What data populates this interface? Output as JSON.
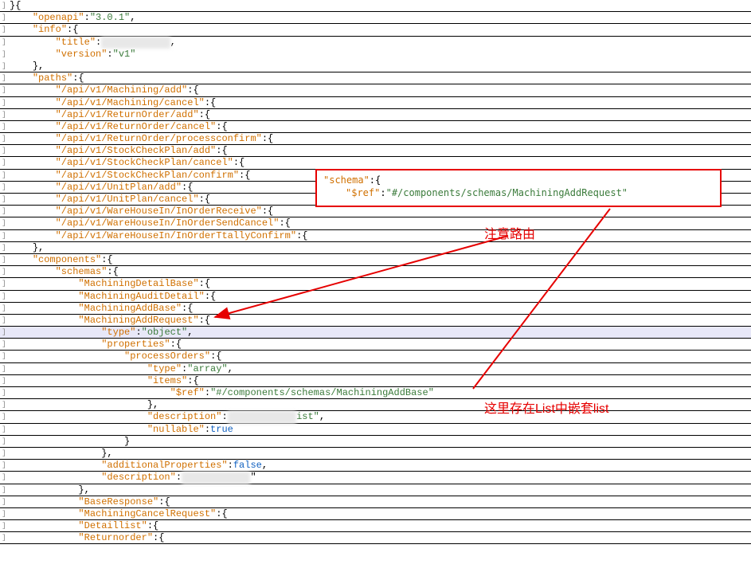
{
  "callout": {
    "line1_key": "\"schema\"",
    "line1_rest": ":{",
    "line2_key": "\"$ref\"",
    "line2_val": "\"#/components/schemas/MachiningAddRequest\""
  },
  "annotations": {
    "top": "注意路由",
    "bottom": "这里存在List中嵌套list"
  },
  "redacted": {
    "title_value": "████████████",
    "desc_suffix": "ist\"",
    "desc2": "████████████"
  },
  "lines": [
    {
      "indent": 0,
      "t": [
        [
          "p",
          "}{"
        ]
      ]
    },
    {
      "indent": 1,
      "t": [
        [
          "k",
          "\"openapi\""
        ],
        [
          "p",
          ":"
        ],
        [
          "s",
          "\"3.0.1\""
        ],
        [
          "p",
          ","
        ]
      ]
    },
    {
      "indent": 1,
      "t": [
        [
          "k",
          "\"info\""
        ],
        [
          "p",
          ":{"
        ]
      ]
    },
    {
      "indent": 2,
      "t": [
        [
          "k",
          "\"title\""
        ],
        [
          "p",
          ":"
        ],
        [
          "blur",
          "redacted.title_value"
        ],
        [
          "p",
          ","
        ]
      ],
      "nb": true
    },
    {
      "indent": 2,
      "t": [
        [
          "k",
          "\"version\""
        ],
        [
          "p",
          ":"
        ],
        [
          "s",
          "\"v1\""
        ]
      ],
      "nb": true
    },
    {
      "indent": 1,
      "t": [
        [
          "p",
          "},"
        ]
      ]
    },
    {
      "indent": 1,
      "t": [
        [
          "k",
          "\"paths\""
        ],
        [
          "p",
          ":{"
        ]
      ]
    },
    {
      "indent": 2,
      "t": [
        [
          "k",
          "\"/api/v1/Machining/add\""
        ],
        [
          "p",
          ":{"
        ]
      ]
    },
    {
      "indent": 2,
      "t": [
        [
          "k",
          "\"/api/v1/Machining/cancel\""
        ],
        [
          "p",
          ":{"
        ]
      ]
    },
    {
      "indent": 2,
      "t": [
        [
          "k",
          "\"/api/v1/ReturnOrder/add\""
        ],
        [
          "p",
          ":{"
        ]
      ]
    },
    {
      "indent": 2,
      "t": [
        [
          "k",
          "\"/api/v1/ReturnOrder/cancel\""
        ],
        [
          "p",
          ":{"
        ]
      ]
    },
    {
      "indent": 2,
      "t": [
        [
          "k",
          "\"/api/v1/ReturnOrder/processconfirm\""
        ],
        [
          "p",
          ":{"
        ]
      ]
    },
    {
      "indent": 2,
      "t": [
        [
          "k",
          "\"/api/v1/StockCheckPlan/add\""
        ],
        [
          "p",
          ":{"
        ]
      ]
    },
    {
      "indent": 2,
      "t": [
        [
          "k",
          "\"/api/v1/StockCheckPlan/cancel\""
        ],
        [
          "p",
          ":{"
        ]
      ]
    },
    {
      "indent": 2,
      "t": [
        [
          "k",
          "\"/api/v1/StockCheckPlan/confirm\""
        ],
        [
          "p",
          ":{"
        ]
      ]
    },
    {
      "indent": 2,
      "t": [
        [
          "k",
          "\"/api/v1/UnitPlan/add\""
        ],
        [
          "p",
          ":{"
        ]
      ]
    },
    {
      "indent": 2,
      "t": [
        [
          "k",
          "\"/api/v1/UnitPlan/cancel\""
        ],
        [
          "p",
          ":{"
        ]
      ]
    },
    {
      "indent": 2,
      "t": [
        [
          "k",
          "\"/api/v1/WareHouseIn/InOrderReceive\""
        ],
        [
          "p",
          ":{"
        ]
      ]
    },
    {
      "indent": 2,
      "t": [
        [
          "k",
          "\"/api/v1/WareHouseIn/InOrderSendCancel\""
        ],
        [
          "p",
          ":{"
        ]
      ]
    },
    {
      "indent": 2,
      "t": [
        [
          "k",
          "\"/api/v1/WareHouseIn/InOrderTtallyConfirm\""
        ],
        [
          "p",
          ":{"
        ]
      ]
    },
    {
      "indent": 1,
      "t": [
        [
          "p",
          "},"
        ]
      ]
    },
    {
      "indent": 1,
      "t": [
        [
          "k",
          "\"components\""
        ],
        [
          "p",
          ":{"
        ]
      ]
    },
    {
      "indent": 2,
      "t": [
        [
          "k",
          "\"schemas\""
        ],
        [
          "p",
          ":{"
        ]
      ]
    },
    {
      "indent": 3,
      "t": [
        [
          "k",
          "\"MachiningDetailBase\""
        ],
        [
          "p",
          ":{"
        ]
      ]
    },
    {
      "indent": 3,
      "t": [
        [
          "k",
          "\"MachiningAuditDetail\""
        ],
        [
          "p",
          ":{"
        ]
      ]
    },
    {
      "indent": 3,
      "t": [
        [
          "k",
          "\"MachiningAddBase\""
        ],
        [
          "p",
          ":{"
        ]
      ]
    },
    {
      "indent": 3,
      "t": [
        [
          "k",
          "\"MachiningAddRequest\""
        ],
        [
          "p",
          ":{"
        ]
      ]
    },
    {
      "indent": 4,
      "t": [
        [
          "k",
          "\"type\""
        ],
        [
          "p",
          ":"
        ],
        [
          "s",
          "\"object\""
        ],
        [
          "p",
          ","
        ]
      ],
      "hl": true
    },
    {
      "indent": 4,
      "t": [
        [
          "k",
          "\"properties\""
        ],
        [
          "p",
          ":{"
        ]
      ]
    },
    {
      "indent": 5,
      "t": [
        [
          "k",
          "\"processOrders\""
        ],
        [
          "p",
          ":{"
        ]
      ]
    },
    {
      "indent": 6,
      "t": [
        [
          "k",
          "\"type\""
        ],
        [
          "p",
          ":"
        ],
        [
          "s",
          "\"array\""
        ],
        [
          "p",
          ","
        ]
      ]
    },
    {
      "indent": 6,
      "t": [
        [
          "k",
          "\"items\""
        ],
        [
          "p",
          ":{"
        ]
      ]
    },
    {
      "indent": 7,
      "t": [
        [
          "k",
          "\"$ref\""
        ],
        [
          "p",
          ":"
        ],
        [
          "s",
          "\"#/components/schemas/MachiningAddBase\""
        ]
      ]
    },
    {
      "indent": 6,
      "t": [
        [
          "p",
          "},"
        ]
      ]
    },
    {
      "indent": 6,
      "t": [
        [
          "k",
          "\"description\""
        ],
        [
          "p",
          ":"
        ],
        [
          "blur",
          "redacted.desc2"
        ],
        [
          "sraw",
          "redacted.desc_suffix"
        ],
        [
          "p",
          ","
        ]
      ]
    },
    {
      "indent": 6,
      "t": [
        [
          "k",
          "\"nullable\""
        ],
        [
          "p",
          ":"
        ],
        [
          "b",
          "true"
        ]
      ]
    },
    {
      "indent": 5,
      "t": [
        [
          "p",
          "}"
        ]
      ]
    },
    {
      "indent": 4,
      "t": [
        [
          "p",
          "},"
        ]
      ]
    },
    {
      "indent": 4,
      "t": [
        [
          "k",
          "\"additionalProperties\""
        ],
        [
          "p",
          ":"
        ],
        [
          "b",
          "false"
        ],
        [
          "p",
          ","
        ]
      ]
    },
    {
      "indent": 4,
      "t": [
        [
          "k",
          "\"description\""
        ],
        [
          "p",
          ":"
        ],
        [
          "blur",
          "redacted.desc2"
        ],
        [
          "p",
          "\""
        ]
      ]
    },
    {
      "indent": 3,
      "t": [
        [
          "p",
          "},"
        ]
      ]
    },
    {
      "indent": 3,
      "t": [
        [
          "k",
          "\"BaseResponse\""
        ],
        [
          "p",
          ":{"
        ]
      ]
    },
    {
      "indent": 3,
      "t": [
        [
          "k",
          "\"MachiningCancelRequest\""
        ],
        [
          "p",
          ":{"
        ]
      ]
    },
    {
      "indent": 3,
      "t": [
        [
          "k",
          "\"Detaillist\""
        ],
        [
          "p",
          ":{"
        ]
      ]
    },
    {
      "indent": 3,
      "t": [
        [
          "k",
          "\"Returnorder\""
        ],
        [
          "p",
          ":{"
        ]
      ]
    }
  ]
}
